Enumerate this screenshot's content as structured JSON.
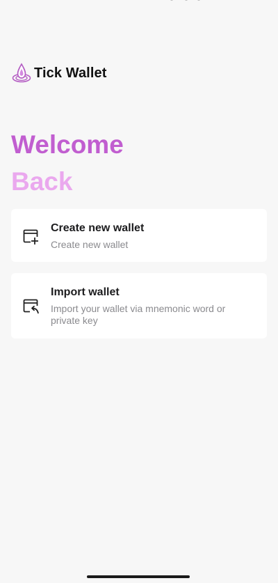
{
  "app": {
    "name": "Tick Wallet"
  },
  "welcome": {
    "line1": "Welcome",
    "line2": "Back"
  },
  "options": [
    {
      "title": "Create new wallet",
      "subtitle": "Create new wallet",
      "icon": "new-window-plus-icon"
    },
    {
      "title": "Import wallet",
      "subtitle": "Import your wallet via mnemonic word or private key",
      "icon": "import-window-arrow-icon"
    }
  ],
  "colors": {
    "accent": "#c15ed0",
    "accent_light": "#eaa8ee",
    "background": "#f7f7f7",
    "card": "#ffffff"
  }
}
